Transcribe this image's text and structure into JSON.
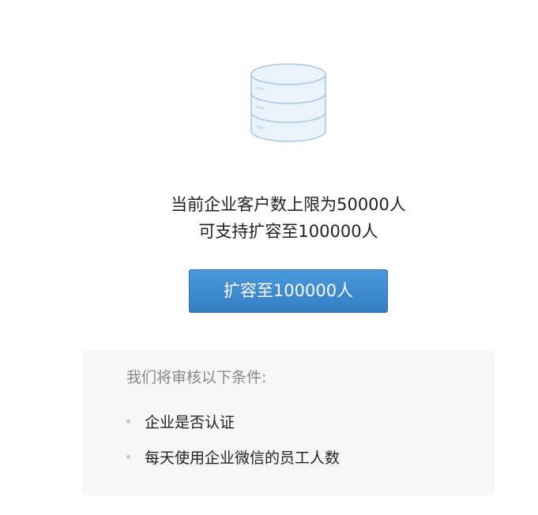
{
  "header": {
    "icon": "database-icon",
    "line1": "当前企业客户数上限为50000人",
    "line2": "可支持扩容至100000人"
  },
  "action": {
    "expand_label": "扩容至100000人"
  },
  "review": {
    "title": "我们将审核以下条件:",
    "items": [
      {
        "label": "企业是否认证"
      },
      {
        "label": "每天使用企业微信的员工人数"
      }
    ]
  },
  "colors": {
    "accent": "#3a87cc",
    "icon_fill": "#eaf3fb",
    "icon_stroke": "#a6c6e4",
    "panel_bg": "#f7f7f7"
  }
}
